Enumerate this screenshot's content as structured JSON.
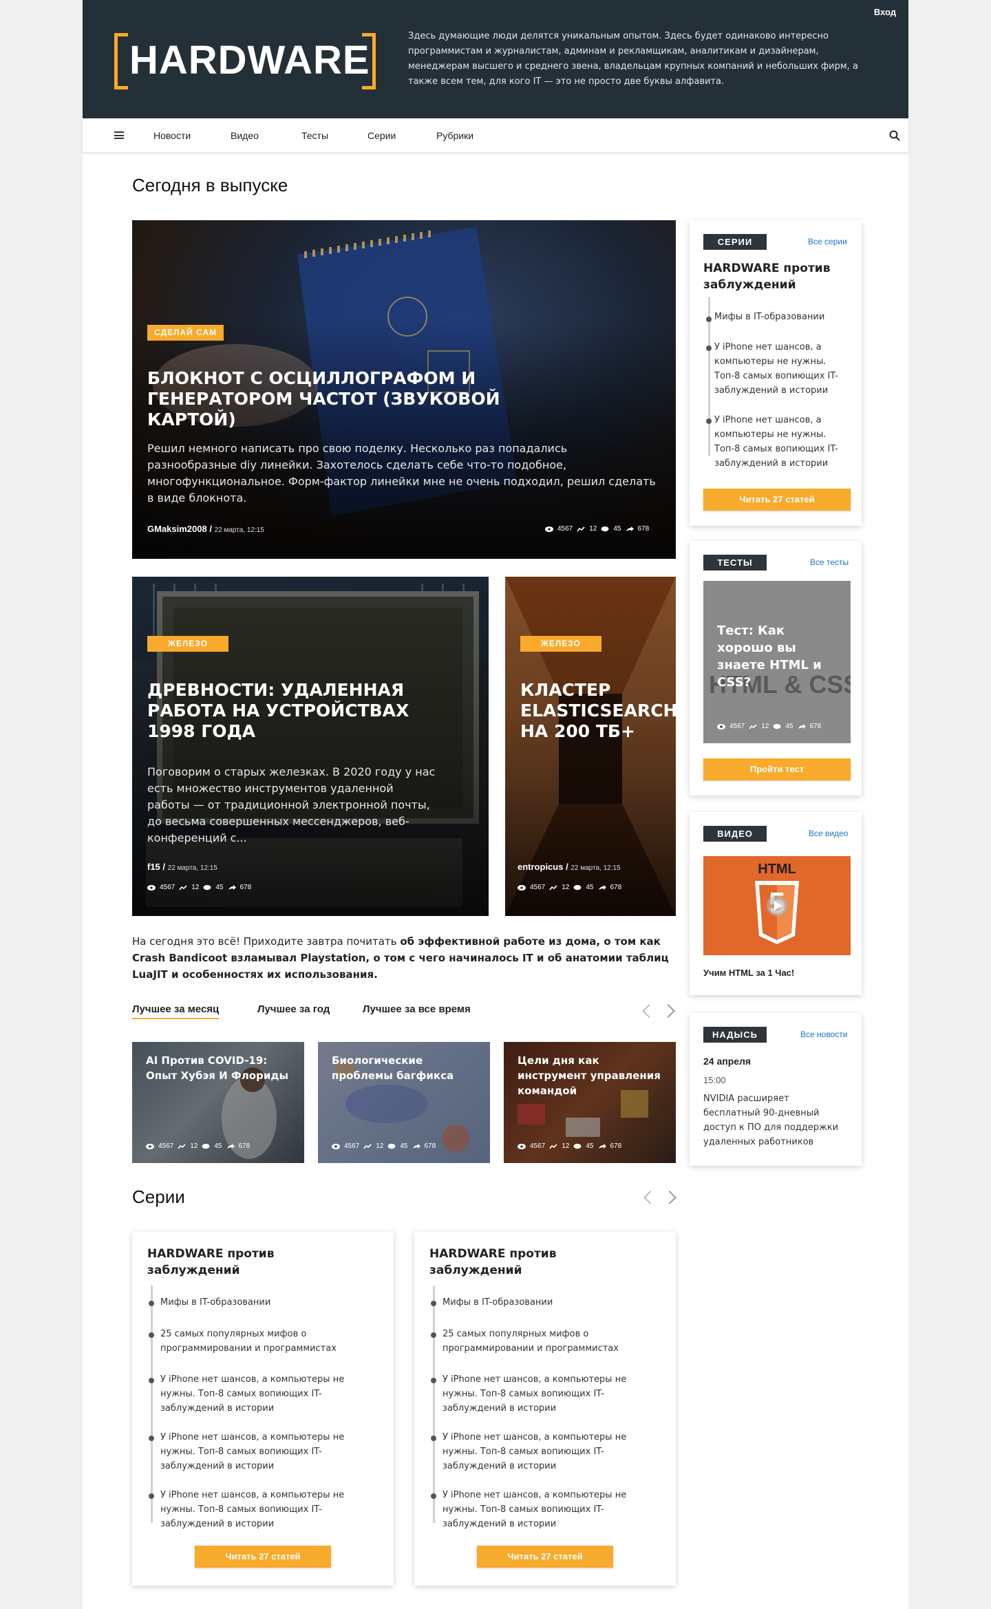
{
  "header": {
    "logo": "HARDWARE",
    "tagline": "Здесь думающие люди делятся уникальным опытом. Здесь будет одинаково интересно программистам и журналистам, админам и рекламщикам, аналитикам и дизайнерам, менеджерам высшего и среднего звена, владельцам крупных компаний и небольших фирм, а также всем тем, для кого IT — это не просто две буквы алфавита.",
    "login": "Вход"
  },
  "nav": {
    "items": [
      "Новости",
      "Видео",
      "Тесты",
      "Серии",
      "Рубрики"
    ],
    "menu_icon": "hamburger-icon",
    "search_icon": "search-icon"
  },
  "today": {
    "heading": "Сегодня в выпуске",
    "main": {
      "tag": "СДЕЛАЙ САМ",
      "title": "Блокнот с осциллографом и генератором частот (звуковой картой)",
      "desc": "Решил немного написать про свою поделку. Несколько раз попадались разнообразные diy линейки. Захотелось сделать себе что-то подобное, многофункциональное. Форм-фактор линейки мне не очень подходил, решил сделать в виде блокнота.",
      "author": "GMaksim2008",
      "date": "22 марта, 12:15",
      "views": "4567",
      "reposts": "12",
      "comments": "45",
      "shares": "678"
    },
    "left": {
      "tag": "ЖЕЛЕЗО",
      "title": "Древности: удаленная работа на устройствах 1998 года",
      "desc": "Поговорим о старых железках. В 2020 году у нас есть множество инструментов удаленной работы — от традиционной электронной почты, до весьма совершенных мессенджеров, веб-конференций с...",
      "author": "f15",
      "date": "22 марта, 12:15",
      "views": "4567",
      "reposts": "12",
      "comments": "45",
      "shares": "678"
    },
    "right": {
      "tag": "ЖЕЛЕЗО",
      "title": "Кластер Elasticsearch на 200 ТБ+",
      "author": "entropicus",
      "date": "22 марта, 12:15",
      "views": "4567",
      "reposts": "12",
      "comments": "45",
      "shares": "678"
    },
    "outro_a": "На сегодня это всё! Приходите завтра почитать ",
    "outro_b": "об эффективной работе из дома,",
    "outro_c": " о том как Crash Bandicoot взламывал Playstation, о том с чего начиналось IT и об анатомии таблиц LuaJIT и особенностях их использования."
  },
  "best": {
    "tabs": [
      "Лучшее за месяц",
      "Лучшее за год",
      "Лучшее за все время"
    ],
    "items": [
      {
        "title": "AI Против COVID-19: Опыт Хубэя И Флориды",
        "views": "4567",
        "reposts": "12",
        "comments": "45",
        "shares": "678"
      },
      {
        "title": "Биологические проблемы багфикса",
        "views": "4567",
        "reposts": "12",
        "comments": "45",
        "shares": "678"
      },
      {
        "title": "Цели дня как инструмент управления командой",
        "views": "4567",
        "reposts": "12",
        "comments": "45",
        "shares": "678"
      }
    ]
  },
  "series_section": {
    "heading": "Серии",
    "cards": [
      {
        "title": "HARDWARE против заблуждений",
        "items": [
          "Мифы в IT-образовании",
          "25 самых популярных мифов о программировании и программистах",
          "У iPhone нет шансов, а компьютеры не нужны. Топ-8 самых вопиющих IT-заблуждений в истории",
          "У iPhone нет шансов, а компьютеры не нужны. Топ-8 самых вопиющих IT-заблуждений в истории",
          "У iPhone нет шансов, а компьютеры не нужны. Топ-8 самых вопиющих IT-заблуждений в истории"
        ],
        "button": "Читать 27 статей"
      },
      {
        "title": "HARDWARE против заблуждений",
        "items": [
          "Мифы в IT-образовании",
          "25 самых популярных мифов о программировании и программистах",
          "У iPhone нет шансов, а компьютеры не нужны. Топ-8 самых вопиющих IT-заблуждений в истории",
          "У iPhone нет шансов, а компьютеры не нужны. Топ-8 самых вопиющих IT-заблуждений в истории",
          "У iPhone нет шансов, а компьютеры не нужны. Топ-8 самых вопиющих IT-заблуждений в истории"
        ],
        "button": "Читать 27 статей"
      }
    ]
  },
  "sidebar": {
    "series": {
      "label": "СЕРИИ",
      "link": "Все серии",
      "title": "HARDWARE против заблуждений",
      "items": [
        "Мифы в IT-образовании",
        "У iPhone нет шансов, а компьютеры не нужны. Топ-8 самых вопиющих IT-заблуждений в истории",
        "У iPhone нет шансов, а компьютеры не нужны. Топ-8 самых вопиющих IT-заблуждений в истории"
      ],
      "button": "Читать 27 статей"
    },
    "tests": {
      "label": "ТЕСТЫ",
      "link": "Все тесты",
      "title": "Тест: Как хорошо вы знаете HTML и CSS?",
      "bg_text": "HTML & CSS",
      "views": "4567",
      "reposts": "12",
      "comments": "45",
      "shares": "678",
      "button": "Пройти тест"
    },
    "video": {
      "label": "ВИДЕО",
      "link": "Все видео",
      "badge": "HTML",
      "shield": "5",
      "title": "Учим HTML за 1 Час!"
    },
    "news": {
      "label": "НАДЫСЬ",
      "link": "Все новости",
      "date": "24 апреля",
      "time": "15:00",
      "text": "NVIDIA расширяет бесплатный 90-дневный доступ к ПО для поддержки удаленных работников"
    }
  },
  "colors": {
    "accent": "#f8aa2c",
    "header_bg": "#243038",
    "link": "#1a73c8"
  }
}
